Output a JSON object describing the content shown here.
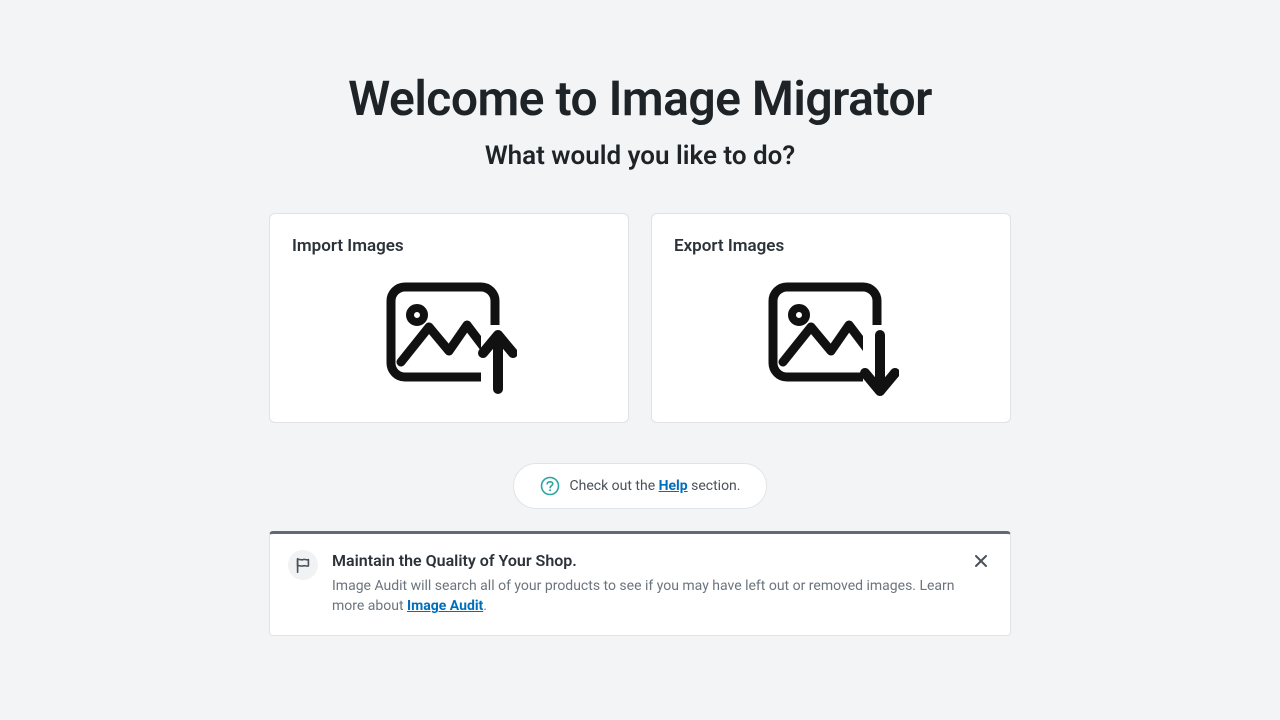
{
  "page": {
    "title": "Welcome to Image Migrator",
    "subtitle": "What would you like to do?"
  },
  "cards": {
    "import_label": "Import Images",
    "export_label": "Export Images"
  },
  "help": {
    "prefix": "Check out the ",
    "link": "Help",
    "suffix": " section."
  },
  "banner": {
    "title": "Maintain the Quality of Your Shop.",
    "desc_prefix": "Image Audit will search all of your products to see if you may have left out or removed images. Learn more about ",
    "link": "Image Audit",
    "suffix": "."
  }
}
